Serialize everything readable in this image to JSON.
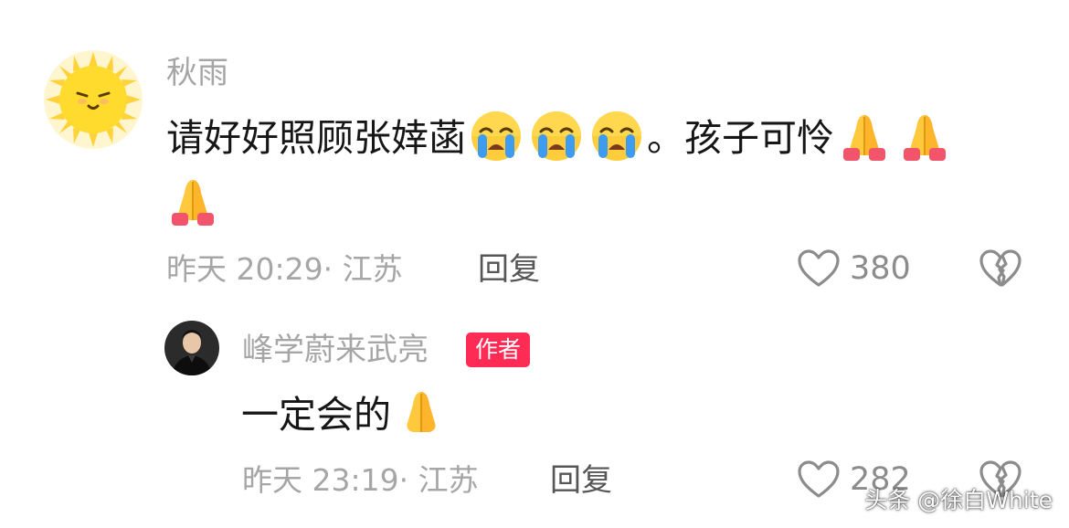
{
  "comments": [
    {
      "username": "秋雨",
      "avatar_icon": "cartoon-sun-avatar",
      "text_part1": "请好好照顾张婞菡",
      "text_emojis_1": [
        "crying-face-emoji",
        "crying-face-emoji",
        "crying-face-emoji"
      ],
      "text_part2": "。孩子可怜",
      "text_emojis_2": [
        "praying-hands-emoji",
        "praying-hands-emoji",
        "praying-hands-emoji"
      ],
      "time": "昨天 20:29",
      "location": "· 江苏",
      "reply_label": "回复",
      "like_count": "380",
      "like_icon": "heart-outline-icon",
      "dislike_icon": "broken-heart-icon"
    }
  ],
  "reply": {
    "username": "峰学蔚来武亮",
    "avatar_icon": "man-in-black-avatar",
    "badge": "作者",
    "text": "一定会的",
    "text_emoji": "praying-hands-emoji",
    "time": "昨天 23:19",
    "location": "· 江苏",
    "reply_label": "回复",
    "like_count": "282",
    "like_icon": "heart-outline-icon",
    "dislike_icon": "broken-heart-icon"
  },
  "watermark": "头条 @徐白White",
  "colors": {
    "author_badge": "#fe2c55",
    "meta_gray": "#a6a6a6",
    "text_dark": "#161616"
  }
}
